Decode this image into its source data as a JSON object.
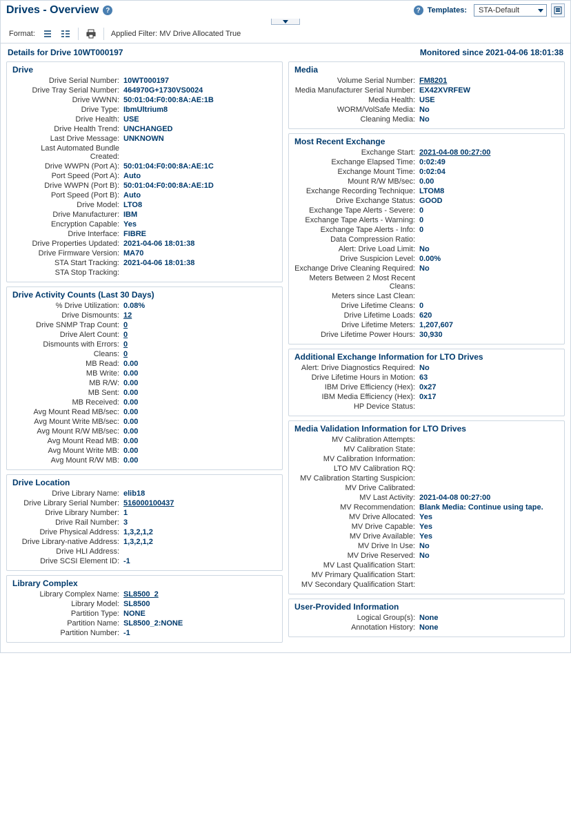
{
  "header": {
    "title": "Drives - Overview",
    "templates_label": "Templates:",
    "template_selected": "STA-Default"
  },
  "toolbar": {
    "format_label": "Format:",
    "applied_filter": "Applied Filter: MV Drive Allocated True"
  },
  "subheader": {
    "details_label": "Details for Drive 10WT000197",
    "monitored_since": "Monitored since 2021-04-06 18:01:38"
  },
  "left": {
    "drive": {
      "title": "Drive",
      "rows": [
        {
          "k": "Drive Serial Number:",
          "v": "10WT000197"
        },
        {
          "k": "Drive Tray Serial Number:",
          "v": "464970G+1730VS0024"
        },
        {
          "k": "Drive WWNN:",
          "v": "50:01:04:F0:00:8A:AE:1B"
        },
        {
          "k": "Drive Type:",
          "v": "IbmUltrium8"
        },
        {
          "k": "Drive Health:",
          "v": "USE"
        },
        {
          "k": "Drive Health Trend:",
          "v": "UNCHANGED"
        },
        {
          "k": "Last Drive Message:",
          "v": "UNKNOWN"
        },
        {
          "k": "Last Automated Bundle Created:",
          "v": ""
        },
        {
          "k": "Drive WWPN (Port A):",
          "v": "50:01:04:F0:00:8A:AE:1C"
        },
        {
          "k": "Port Speed (Port A):",
          "v": "Auto"
        },
        {
          "k": "Drive WWPN (Port B):",
          "v": "50:01:04:F0:00:8A:AE:1D"
        },
        {
          "k": "Port Speed (Port B):",
          "v": "Auto"
        },
        {
          "k": "Drive Model:",
          "v": "LTO8"
        },
        {
          "k": "Drive Manufacturer:",
          "v": "IBM"
        },
        {
          "k": "Encryption Capable:",
          "v": "Yes"
        },
        {
          "k": "Drive Interface:",
          "v": "FIBRE"
        },
        {
          "k": "Drive Properties Updated:",
          "v": "2021-04-06 18:01:38"
        },
        {
          "k": "Drive Firmware Version:",
          "v": "MA70"
        },
        {
          "k": "STA Start Tracking:",
          "v": "2021-04-06 18:01:38"
        },
        {
          "k": "STA Stop Tracking:",
          "v": ""
        }
      ]
    },
    "activity": {
      "title": "Drive Activity Counts (Last 30 Days)",
      "rows": [
        {
          "k": "% Drive Utilization:",
          "v": "0.08%"
        },
        {
          "k": "Drive Dismounts:",
          "v": "12",
          "link": true
        },
        {
          "k": "Drive SNMP Trap Count:",
          "v": "0",
          "link": true
        },
        {
          "k": "Drive Alert Count:",
          "v": "0",
          "link": true
        },
        {
          "k": "Dismounts with Errors:",
          "v": "0",
          "link": true
        },
        {
          "k": "Cleans:",
          "v": "0",
          "link": true
        },
        {
          "k": "MB Read:",
          "v": "0.00"
        },
        {
          "k": "MB Write:",
          "v": "0.00"
        },
        {
          "k": "MB R/W:",
          "v": "0.00"
        },
        {
          "k": "MB Sent:",
          "v": "0.00"
        },
        {
          "k": "MB Received:",
          "v": "0.00"
        },
        {
          "k": "Avg Mount Read MB/sec:",
          "v": "0.00"
        },
        {
          "k": "Avg Mount Write MB/sec:",
          "v": "0.00"
        },
        {
          "k": "Avg Mount R/W MB/sec:",
          "v": "0.00"
        },
        {
          "k": "Avg Mount Read MB:",
          "v": "0.00"
        },
        {
          "k": "Avg Mount Write MB:",
          "v": "0.00"
        },
        {
          "k": "Avg Mount R/W MB:",
          "v": "0.00"
        }
      ]
    },
    "location": {
      "title": "Drive Location",
      "rows": [
        {
          "k": "Drive Library Name:",
          "v": "elib18"
        },
        {
          "k": "Drive Library Serial Number:",
          "v": "516000100437",
          "link": true
        },
        {
          "k": "Drive Library Number:",
          "v": "1"
        },
        {
          "k": "Drive Rail Number:",
          "v": "3"
        },
        {
          "k": "Drive Physical Address:",
          "v": "1,3,2,1,2"
        },
        {
          "k": "Drive Library-native Address:",
          "v": "1,3,2,1,2"
        },
        {
          "k": "Drive HLI Address:",
          "v": ""
        },
        {
          "k": "Drive SCSI Element ID:",
          "v": "-1"
        }
      ]
    },
    "library": {
      "title": "Library Complex",
      "rows": [
        {
          "k": "Library Complex Name:",
          "v": "SL8500_2",
          "link": true
        },
        {
          "k": "Library Model:",
          "v": "SL8500"
        },
        {
          "k": "Partition Type:",
          "v": "NONE"
        },
        {
          "k": "Partition Name:",
          "v": "SL8500_2:NONE"
        },
        {
          "k": "Partition Number:",
          "v": "-1"
        }
      ]
    }
  },
  "right": {
    "media": {
      "title": "Media",
      "rows": [
        {
          "k": "Volume Serial Number:",
          "v": "FM8201",
          "link": true
        },
        {
          "k": "Media Manufacturer Serial Number:",
          "v": "EX42XVRFEW"
        },
        {
          "k": "Media Health:",
          "v": "USE"
        },
        {
          "k": "WORM/VolSafe Media:",
          "v": "No"
        },
        {
          "k": "Cleaning Media:",
          "v": "No"
        }
      ]
    },
    "exchange": {
      "title": "Most Recent Exchange",
      "rows": [
        {
          "k": "Exchange Start:",
          "v": "2021-04-08 00:27:00",
          "link": true
        },
        {
          "k": "Exchange Elapsed Time:",
          "v": "0:02:49"
        },
        {
          "k": "Exchange Mount Time:",
          "v": "0:02:04"
        },
        {
          "k": "Mount R/W MB/sec:",
          "v": "0.00"
        },
        {
          "k": "Exchange Recording Technique:",
          "v": "LTOM8"
        },
        {
          "k": "Drive Exchange Status:",
          "v": "GOOD"
        },
        {
          "k": "Exchange Tape Alerts - Severe:",
          "v": "0"
        },
        {
          "k": "Exchange Tape Alerts - Warning:",
          "v": "0"
        },
        {
          "k": "Exchange Tape Alerts - Info:",
          "v": "0"
        },
        {
          "k": "Data Compression Ratio:",
          "v": ""
        },
        {
          "k": "Alert: Drive Load Limit:",
          "v": "No"
        },
        {
          "k": "Drive Suspicion Level:",
          "v": "0.00%"
        },
        {
          "k": "Exchange Drive Cleaning Required:",
          "v": "No"
        },
        {
          "k": "Meters Between 2 Most Recent Cleans:",
          "v": ""
        },
        {
          "k": "Meters since Last Clean:",
          "v": ""
        },
        {
          "k": "Drive Lifetime Cleans:",
          "v": "0"
        },
        {
          "k": "Drive Lifetime Loads:",
          "v": "620"
        },
        {
          "k": "Drive Lifetime Meters:",
          "v": "1,207,607"
        },
        {
          "k": "Drive Lifetime Power Hours:",
          "v": "30,930"
        }
      ]
    },
    "lto": {
      "title": "Additional Exchange Information for LTO Drives",
      "rows": [
        {
          "k": "Alert: Drive Diagnostics Required:",
          "v": "No"
        },
        {
          "k": "Drive Lifetime Hours in Motion:",
          "v": "63"
        },
        {
          "k": "IBM Drive Efficiency (Hex):",
          "v": "0x27"
        },
        {
          "k": "IBM Media Efficiency (Hex):",
          "v": "0x17"
        },
        {
          "k": "HP Device Status:",
          "v": ""
        }
      ]
    },
    "mv": {
      "title": "Media Validation Information for LTO Drives",
      "rows": [
        {
          "k": "MV Calibration Attempts:",
          "v": ""
        },
        {
          "k": "MV Calibration State:",
          "v": ""
        },
        {
          "k": "MV Calibration Information:",
          "v": ""
        },
        {
          "k": "LTO MV Calibration RQ:",
          "v": ""
        },
        {
          "k": "MV Calibration Starting Suspicion:",
          "v": ""
        },
        {
          "k": "MV Drive Calibrated:",
          "v": ""
        },
        {
          "k": "MV Last Activity:",
          "v": "2021-04-08 00:27:00"
        },
        {
          "k": "MV Recommendation:",
          "v": "Blank Media: Continue using tape."
        },
        {
          "k": "MV Drive Allocated:",
          "v": "Yes"
        },
        {
          "k": "MV Drive Capable:",
          "v": "Yes"
        },
        {
          "k": "MV Drive Available:",
          "v": "Yes"
        },
        {
          "k": "MV Drive In Use:",
          "v": "No"
        },
        {
          "k": "MV Drive Reserved:",
          "v": "No"
        },
        {
          "k": "MV Last Qualification Start:",
          "v": ""
        },
        {
          "k": "MV Primary Qualification Start:",
          "v": ""
        },
        {
          "k": "MV Secondary Qualification Start:",
          "v": ""
        }
      ]
    },
    "user": {
      "title": "User-Provided Information",
      "rows": [
        {
          "k": "Logical Group(s):",
          "v": "None"
        },
        {
          "k": "Annotation History:",
          "v": "None"
        }
      ]
    }
  }
}
